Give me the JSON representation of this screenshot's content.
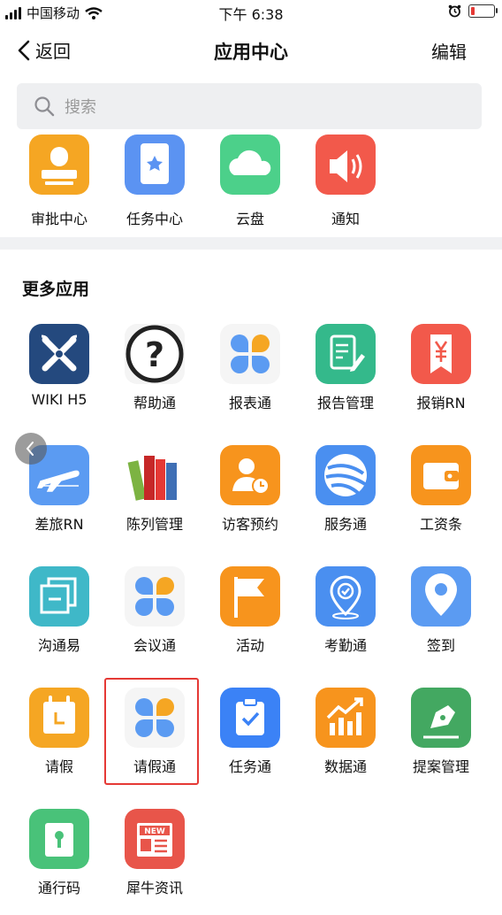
{
  "status_bar": {
    "carrier": "中国移动",
    "time": "下午 6:38",
    "battery_level": 0.15
  },
  "nav": {
    "back_label": "返回",
    "title": "应用中心",
    "edit_label": "编辑"
  },
  "search": {
    "placeholder": "搜索"
  },
  "recent_apps": [
    {
      "label": "审批中心",
      "icon": "approval-stamp-icon"
    },
    {
      "label": "任务中心",
      "icon": "task-bookmark-icon"
    },
    {
      "label": "云盘",
      "icon": "cloud-icon"
    },
    {
      "label": "通知",
      "icon": "speaker-icon"
    }
  ],
  "more_apps": {
    "title": "更多应用",
    "items": [
      {
        "label": "WIKI H5",
        "icon": "wiki-logo-icon"
      },
      {
        "label": "帮助通",
        "icon": "question-icon"
      },
      {
        "label": "报表通",
        "icon": "clover-icon"
      },
      {
        "label": "报告管理",
        "icon": "report-edit-icon"
      },
      {
        "label": "报销RN",
        "icon": "yen-icon"
      },
      {
        "label": "差旅RN",
        "icon": "airplane-icon"
      },
      {
        "label": "陈列管理",
        "icon": "books-icon"
      },
      {
        "label": "访客预约",
        "icon": "visitor-clock-icon"
      },
      {
        "label": "服务通",
        "icon": "swirl-logo-icon"
      },
      {
        "label": "工资条",
        "icon": "wallet-icon"
      },
      {
        "label": "沟通易",
        "icon": "windows-icon"
      },
      {
        "label": "会议通",
        "icon": "clover-icon"
      },
      {
        "label": "活动",
        "icon": "flag-icon"
      },
      {
        "label": "考勤通",
        "icon": "location-clock-icon"
      },
      {
        "label": "签到",
        "icon": "location-pin-icon"
      },
      {
        "label": "请假",
        "icon": "calendar-icon"
      },
      {
        "label": "请假通",
        "icon": "clover-icon"
      },
      {
        "label": "任务通",
        "icon": "clipboard-check-icon"
      },
      {
        "label": "数据通",
        "icon": "bar-chart-icon"
      },
      {
        "label": "提案管理",
        "icon": "pen-icon"
      },
      {
        "label": "通行码",
        "icon": "keyhole-icon"
      },
      {
        "label": "犀牛资讯",
        "icon": "news-icon"
      }
    ]
  },
  "colors": {
    "highlight": "#e53935",
    "accent_blue": "#4a90e2"
  }
}
